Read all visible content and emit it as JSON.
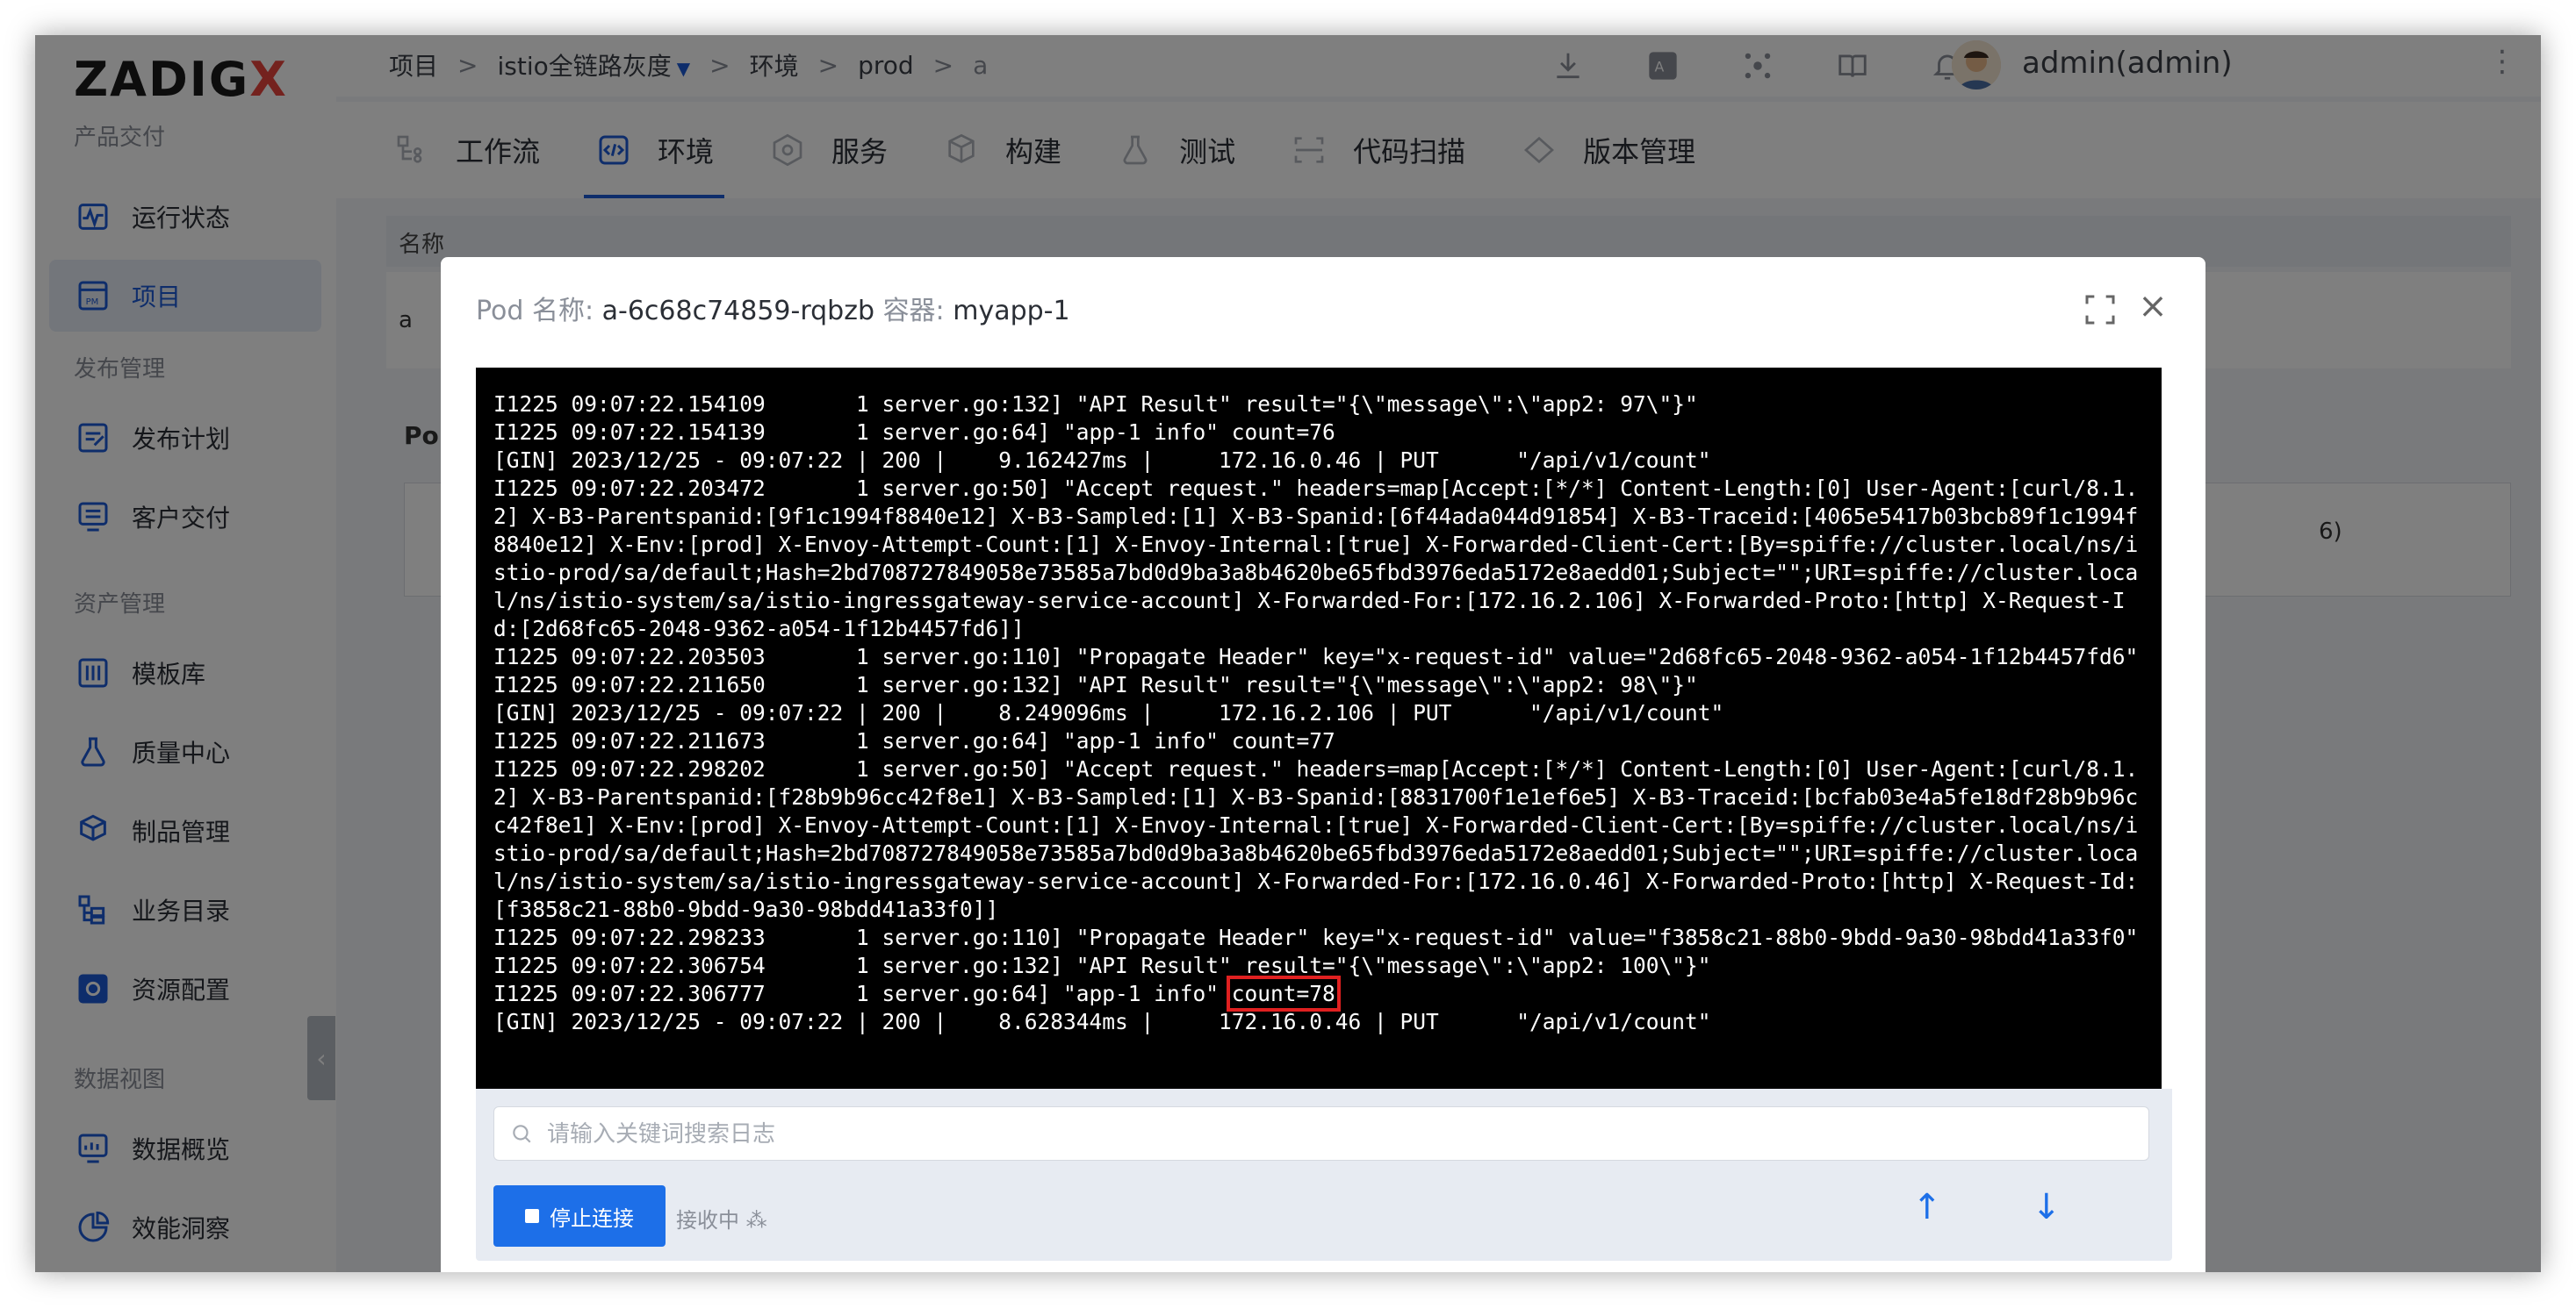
{
  "brand": {
    "logo_text": "ZADIG",
    "logo_x": "X",
    "accent": "#1d5bd6",
    "logo_red": "#e8453c"
  },
  "sidebar": {
    "sections": [
      "产品交付",
      "发布管理",
      "资产管理",
      "数据视图"
    ],
    "items": [
      {
        "label": "运行状态",
        "icon": "pulse-icon"
      },
      {
        "label": "项目",
        "icon": "project-icon"
      },
      {
        "label": "发布计划",
        "icon": "release-plan-icon"
      },
      {
        "label": "客户交付",
        "icon": "delivery-icon"
      },
      {
        "label": "模板库",
        "icon": "template-icon"
      },
      {
        "label": "质量中心",
        "icon": "flask-icon"
      },
      {
        "label": "制品管理",
        "icon": "artifact-icon"
      },
      {
        "label": "业务目录",
        "icon": "catalog-icon"
      },
      {
        "label": "资源配置",
        "icon": "gear-icon"
      },
      {
        "label": "数据概览",
        "icon": "monitor-icon"
      },
      {
        "label": "效能洞察",
        "icon": "pie-icon"
      }
    ],
    "active": "项目"
  },
  "breadcrumb": {
    "items": [
      "项目",
      "istio全链路灰度",
      "环境",
      "prod",
      "a"
    ],
    "sep": ">"
  },
  "header": {
    "user": "admin(admin)"
  },
  "navtabs": [
    "工作流",
    "环境",
    "服务",
    "构建",
    "测试",
    "代码扫描",
    "版本管理"
  ],
  "active_tab": "环境",
  "background": {
    "table_head": "名称",
    "pod_label": "Po",
    "row_first": "a",
    "right_count": "6)"
  },
  "modal": {
    "pod_key": "Pod 名称:",
    "pod_name": "a-6c68c74859-rqbzb",
    "container_key": "容器:",
    "container_name": "myapp-1",
    "log_lines": [
      "I1225 09:07:22.154109       1 server.go:132] \"API Result\" result=\"{\\\"message\\\":\\\"app2: 97\\\"}\"",
      "I1225 09:07:22.154139       1 server.go:64] \"app-1 info\" count=76",
      "[GIN] 2023/12/25 - 09:07:22 | 200 |    9.162427ms |     172.16.0.46 | PUT      \"/api/v1/count\"",
      "I1225 09:07:22.203472       1 server.go:50] \"Accept request.\" headers=map[Accept:[*/*] Content-Length:[0] User-Agent:[curl/8.1.2] X-B3-Parentspanid:[9f1c1994f8840e12] X-B3-Sampled:[1] X-B3-Spanid:[6f44ada044d91854] X-B3-Traceid:[4065e5417b03bcb89f1c1994f8840e12] X-Env:[prod] X-Envoy-Attempt-Count:[1] X-Envoy-Internal:[true] X-Forwarded-Client-Cert:[By=spiffe://cluster.local/ns/istio-prod/sa/default;Hash=2bd708727849058e73585a7bd0d9ba3a8b4620be65fbd3976eda5172e8aedd01;Subject=\"\";URI=spiffe://cluster.local/ns/istio-system/sa/istio-ingressgateway-service-account] X-Forwarded-For:[172.16.2.106] X-Forwarded-Proto:[http] X-Request-Id:[2d68fc65-2048-9362-a054-1f12b4457fd6]]",
      "I1225 09:07:22.203503       1 server.go:110] \"Propagate Header\" key=\"x-request-id\" value=\"2d68fc65-2048-9362-a054-1f12b4457fd6\"",
      "I1225 09:07:22.211650       1 server.go:132] \"API Result\" result=\"{\\\"message\\\":\\\"app2: 98\\\"}\"",
      "[GIN] 2023/12/25 - 09:07:22 | 200 |    8.249096ms |     172.16.2.106 | PUT      \"/api/v1/count\"",
      "I1225 09:07:22.211673       1 server.go:64] \"app-1 info\" count=77",
      "I1225 09:07:22.298202       1 server.go:50] \"Accept request.\" headers=map[Accept:[*/*] Content-Length:[0] User-Agent:[curl/8.1.2] X-B3-Parentspanid:[f28b9b96cc42f8e1] X-B3-Sampled:[1] X-B3-Spanid:[8831700f1e1ef6e5] X-B3-Traceid:[bcfab03e4a5fe18df28b9b96cc42f8e1] X-Env:[prod] X-Envoy-Attempt-Count:[1] X-Envoy-Internal:[true] X-Forwarded-Client-Cert:[By=spiffe://cluster.local/ns/istio-prod/sa/default;Hash=2bd708727849058e73585a7bd0d9ba3a8b4620be65fbd3976eda5172e8aedd01;Subject=\"\";URI=spiffe://cluster.local/ns/istio-system/sa/istio-ingressgateway-service-account] X-Forwarded-For:[172.16.0.46] X-Forwarded-Proto:[http] X-Request-Id:[f3858c21-88b0-9bdd-9a30-98bdd41a33f0]]",
      "I1225 09:07:22.298233       1 server.go:110] \"Propagate Header\" key=\"x-request-id\" value=\"f3858c21-88b0-9bdd-9a30-98bdd41a33f0\"",
      "I1225 09:07:22.306754       1 server.go:132] \"API Result\" result=\"{\\\"message\\\":\\\"app2: 100\\\"}\""
    ],
    "highlight_line_prefix": "I1225 09:07:22.306777       1 server.go:64] \"app-1 info\" ",
    "highlight_text": "count=78",
    "last_line": "[GIN] 2023/12/25 - 09:07:22 | 200 |    8.628344ms |     172.16.0.46 | PUT      \"/api/v1/count\"",
    "search_placeholder": "请输入关键词搜索日志",
    "stop_label": "停止连接",
    "receiving": "接收中",
    "up_arrow": "↑",
    "down_arrow": "↓"
  }
}
